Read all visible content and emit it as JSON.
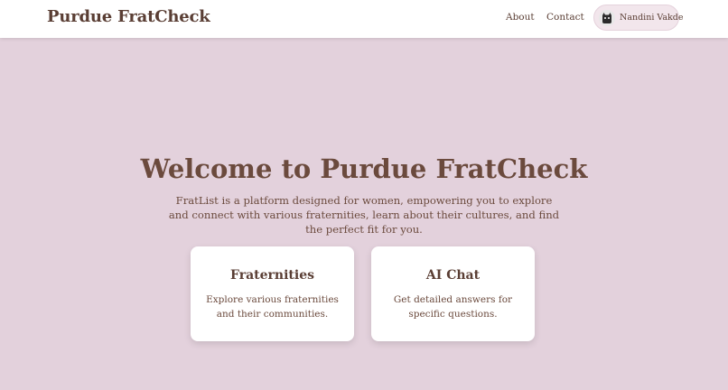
{
  "header": {
    "brand": "Purdue FratCheck",
    "nav": [
      {
        "label": "About"
      },
      {
        "label": "Contact"
      }
    ],
    "user": {
      "name": "Nandini Vakde",
      "avatar_icon": "cat-avatar-icon"
    }
  },
  "hero": {
    "title": "Welcome to Purdue FratCheck",
    "description": "FratList is a platform designed for women, empowering you to explore and connect with various fraternities, learn about their cultures, and find the perfect fit for you."
  },
  "cards": [
    {
      "title": "Fraternities",
      "description": "Explore various fraternities and their communities."
    },
    {
      "title": "AI Chat",
      "description": "Get detailed answers for specific questions."
    }
  ],
  "colors": {
    "background": "#e3d1dc",
    "text": "#6b4a3d",
    "header_bg": "#ffffff",
    "card_bg": "#ffffff"
  }
}
